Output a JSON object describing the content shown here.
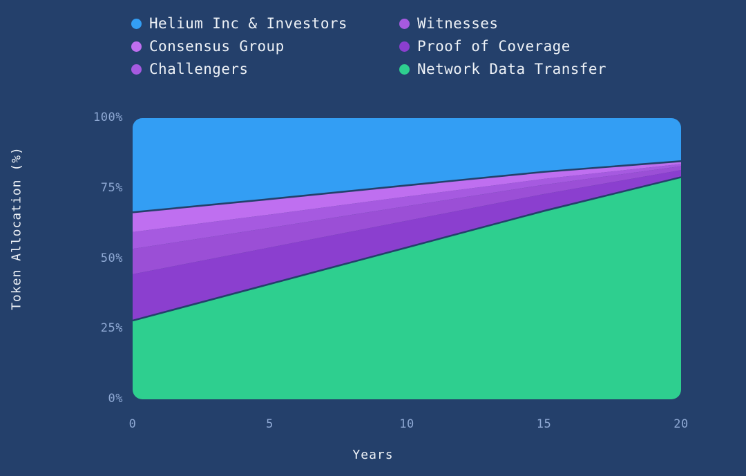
{
  "chart_data": {
    "type": "area",
    "title": "",
    "subtitle": "",
    "xlabel": "Years",
    "ylabel": "Token Allocation (%)",
    "xlim": [
      0,
      20
    ],
    "ylim": [
      0,
      100
    ],
    "grid": false,
    "stacked": true,
    "legend_position": "top",
    "x": [
      0,
      5,
      10,
      15,
      20
    ],
    "xticks": [
      "0",
      "5",
      "10",
      "15",
      "20"
    ],
    "yticks": [
      "0%",
      "25%",
      "50%",
      "75%",
      "100%"
    ],
    "ytick_values": [
      0,
      25,
      50,
      75,
      100
    ],
    "series": [
      {
        "name": "Network Data Transfer",
        "color": "#2ecf8f",
        "values": [
          28,
          41,
          54,
          67,
          79
        ]
      },
      {
        "name": "Challengers",
        "color": "#8b3fcf",
        "values": [
          16.5,
          13,
          9.5,
          6,
          2.5
        ]
      },
      {
        "name": "Proof of Coverage",
        "color": "#9b4fd6",
        "values": [
          9,
          7,
          5.2,
          3.3,
          1.4
        ]
      },
      {
        "name": "Witnesses",
        "color": "#a65ae0",
        "values": [
          6,
          4.7,
          3.4,
          2.1,
          0.8
        ]
      },
      {
        "name": "Consensus Group",
        "color": "#bf6ff0",
        "values": [
          7,
          5.5,
          4,
          2.5,
          1.0
        ]
      },
      {
        "name": "Helium Inc & Investors",
        "color": "#339ef4",
        "values": [
          33.5,
          28.8,
          23.9,
          19.1,
          15.3
        ]
      }
    ]
  },
  "legend": {
    "items": [
      {
        "label": "Helium Inc & Investors",
        "color": "#339ef4",
        "column": 0,
        "row": 0
      },
      {
        "label": "Consensus Group",
        "color": "#bf6ff0",
        "column": 0,
        "row": 1
      },
      {
        "label": "Challengers",
        "color": "#a65ae0",
        "column": 0,
        "row": 2
      },
      {
        "label": "Witnesses",
        "color": "#a65ae0",
        "column": 1,
        "row": 0
      },
      {
        "label": "Proof of Coverage",
        "color": "#8b3fcf",
        "column": 1,
        "row": 1
      },
      {
        "label": "Network Data Transfer",
        "color": "#2ecf8f",
        "column": 1,
        "row": 2
      }
    ]
  },
  "theme": {
    "background": "#24406b",
    "text_color": "#eef2f7",
    "tick_color": "#8fa9d4",
    "separator_color": "#24406b"
  }
}
